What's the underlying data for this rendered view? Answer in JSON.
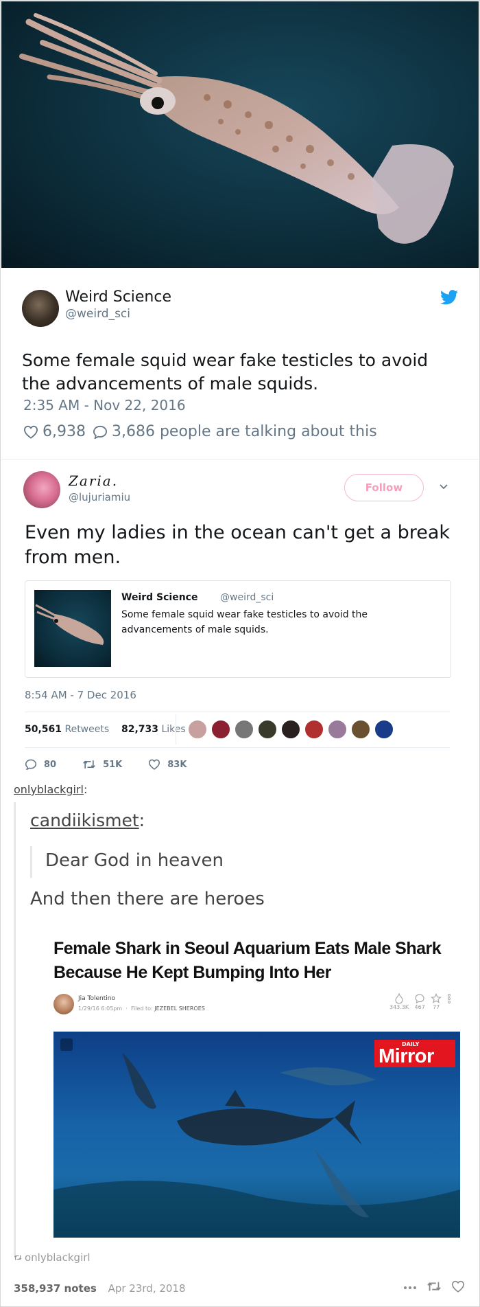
{
  "tweet1": {
    "name": "Weird Science",
    "handle": "@weird_sci",
    "text": "Some female squid wear fake testicles to avoid the advancements of male squids.",
    "time": "2:35 AM - Nov 22, 2016",
    "likes": "6,938",
    "talking": "3,686 people are talking about this"
  },
  "tweet2": {
    "name": "Zaria.",
    "handle": "@lujuriamiu",
    "follow_label": "Follow",
    "text": "Even my ladies in the ocean can't get a break from men.",
    "quote": {
      "name": "Weird Science",
      "handle": "@weird_sci",
      "text": "Some female squid wear fake testicles to avoid the advancements of male squids."
    },
    "time": "8:54 AM - 7 Dec 2016",
    "retweets_count": "50,561",
    "retweets_label": "Retweets",
    "likes_count": "82,733",
    "likes_label": "Likes",
    "replies_action": "80",
    "retweets_action": "51K",
    "likes_action": "83K"
  },
  "tumblr": {
    "reblogger": "onlyblackgirl",
    "quoted_user": "candiikismet",
    "quote_text": "Dear God in heaven",
    "reply_text": "And then there are heroes",
    "source": "onlyblackgirl",
    "notes": "358,937 notes",
    "date": "Apr 23rd, 2018"
  },
  "article": {
    "title": "Female Shark in Seoul Aquarium Eats Male Shark Because He Kept Bumping Into Her",
    "author": "Jia Tolentino",
    "date": "1/29/16 6:05pm",
    "filed_label": "Filed to:",
    "filed_to": "JEZEBEL SHEROES",
    "views": "343.3K",
    "comments": "467",
    "stars": "77",
    "logo_small": "DAILY",
    "logo_big": "Mirror"
  },
  "colors": {
    "twitter_blue": "#1da1f2",
    "follow_pink": "#f4a0bc",
    "mirror_red": "#e3161f"
  }
}
